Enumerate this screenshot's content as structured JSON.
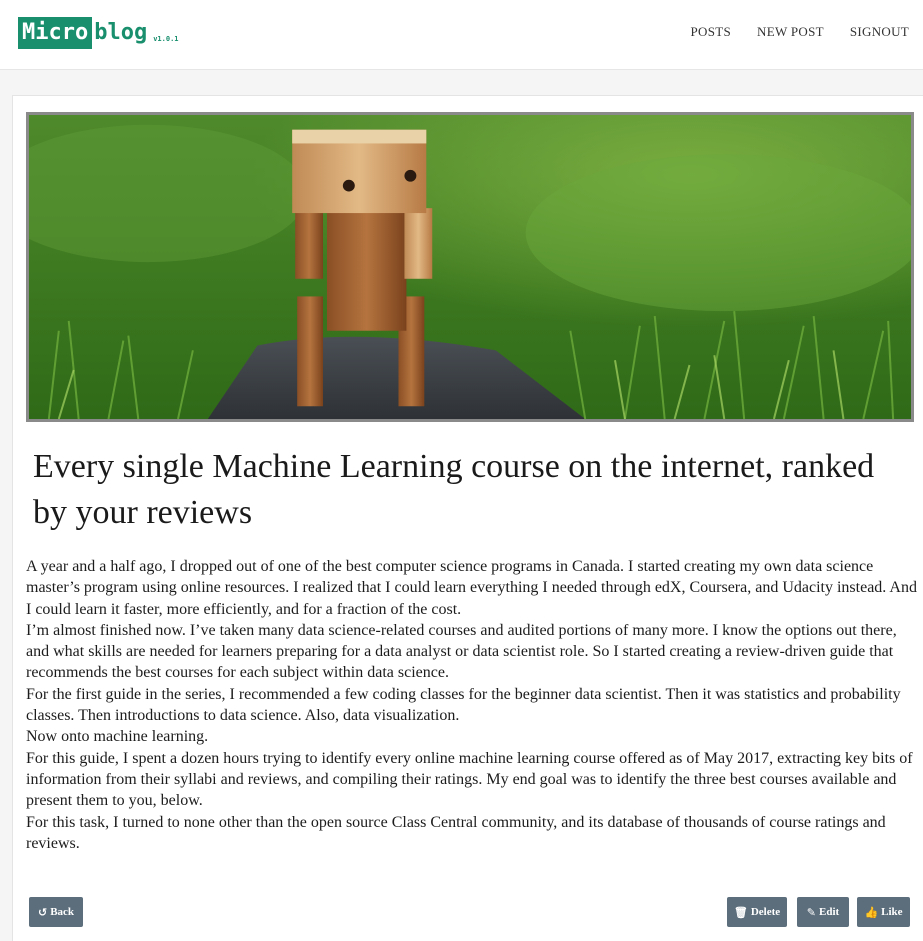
{
  "header": {
    "logo_box": "Micro",
    "logo_text": "blog",
    "version": "v1.0.1",
    "nav": [
      {
        "label": "POSTS"
      },
      {
        "label": "NEW POST"
      },
      {
        "label": "SIGNOUT"
      }
    ]
  },
  "post": {
    "image_alt": "wooden robot toy on grass",
    "title": "Every single Machine Learning course on the internet, ranked by your reviews",
    "paragraphs": [
      "A year and a half ago, I dropped out of one of the best computer science programs in Canada. I started creating my own data science master’s program using online resources. I realized that I could learn everything I needed through edX, Coursera, and Udacity instead. And I could learn it faster, more efficiently, and for a fraction of the cost.",
      "I’m almost finished now. I’ve taken many data science-related courses and audited portions of many more. I know the options out there, and what skills are needed for learners preparing for a data analyst or data scientist role. So I started creating a review-driven guide that recommends the best courses for each subject within data science.",
      "For the first guide in the series, I recommended a few coding classes for the beginner data scientist. Then it was statistics and probability classes. Then introductions to data science. Also, data visualization.",
      "Now onto machine learning.",
      "For this guide, I spent a dozen hours trying to identify every online machine learning course offered as of May 2017, extracting key bits of information from their syllabi and reviews, and compiling their ratings. My end goal was to identify the three best courses available and present them to you, below.",
      "For this task, I turned to none other than the open source Class Central community, and its database of thousands of course ratings and reviews."
    ]
  },
  "actions": {
    "back_label": "Back",
    "delete_label": "Delete",
    "edit_label": "Edit",
    "like_label": "Like"
  },
  "colors": {
    "brand": "#1a8f6e",
    "button": "#5c6e7c"
  }
}
